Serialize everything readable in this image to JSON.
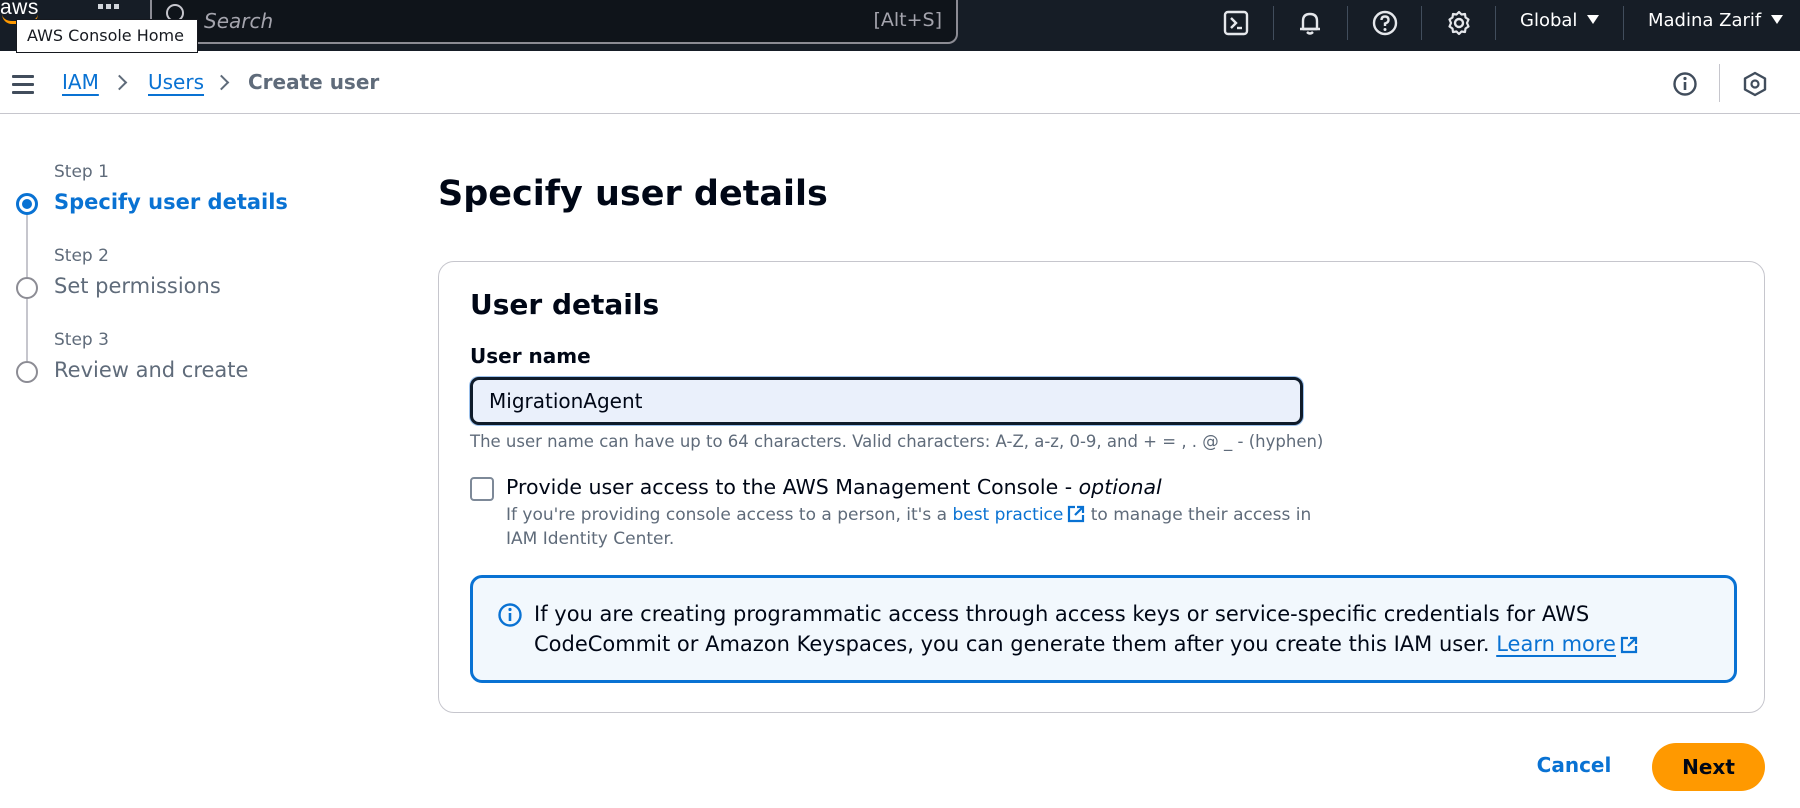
{
  "topnav": {
    "logo_text": "aws",
    "tooltip": "AWS Console Home",
    "search_placeholder": "Search",
    "search_shortcut": "[Alt+S]",
    "region": "Global",
    "user": "Madina Zarif",
    "icons": [
      "services-grid-icon",
      "search-icon",
      "cloudshell-icon",
      "bell-icon",
      "help-icon",
      "settings-icon"
    ]
  },
  "breadcrumb": {
    "items": [
      "IAM",
      "Users",
      "Create user"
    ]
  },
  "steps": [
    {
      "number": "Step 1",
      "title": "Specify user details",
      "state": "active"
    },
    {
      "number": "Step 2",
      "title": "Set permissions",
      "state": "pending"
    },
    {
      "number": "Step 3",
      "title": "Review and create",
      "state": "pending"
    }
  ],
  "page_title": "Specify user details",
  "user_details": {
    "title": "User details",
    "field_label": "User name",
    "field_value": "MigrationAgent",
    "hint": "The user name can have up to 64 characters. Valid characters: A-Z, a-z, 0-9, and + = , . @ _ - (hyphen)",
    "checkbox_label": "Provide user access to the AWS Management Console - ",
    "checkbox_label_optional": "optional",
    "checkbox_checked": false,
    "desc_before": "If you're providing console access to a person, it's a ",
    "desc_link": "best practice",
    "desc_after": " to manage their access in IAM Identity Center."
  },
  "info_alert": {
    "text": "If you are creating programmatic access through access keys or service-specific credentials for AWS CodeCommit or Amazon Keyspaces, you can generate them after you create this IAM user. ",
    "link": "Learn more"
  },
  "actions": {
    "cancel": "Cancel",
    "next": "Next"
  },
  "colors": {
    "nav_bg": "#161d26",
    "link": "#0972d3",
    "primary_button": "#ff9900",
    "alert_bg": "#f2f8fd"
  }
}
